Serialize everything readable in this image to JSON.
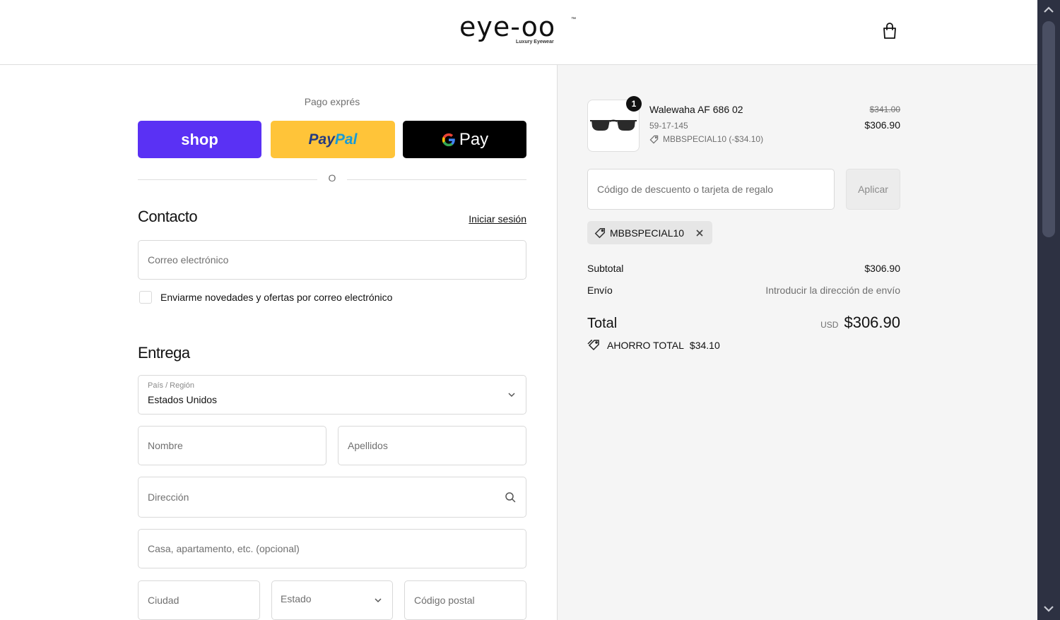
{
  "header": {
    "brand": "eye-oo",
    "brand_tm": "™",
    "brand_sub": "Luxury Eyewear",
    "cart_icon": "shopping-bag-icon"
  },
  "express": {
    "title": "Pago exprés",
    "shop_label": "shop",
    "paypal_part1": "Pay",
    "paypal_part2": "Pal",
    "gpay_label": "Pay",
    "or_label": "O",
    "colors": {
      "shop": "#5a31f4",
      "paypal": "#ffc439",
      "gpay": "#000000"
    }
  },
  "contact": {
    "title": "Contacto",
    "login_link": "Iniciar sesión",
    "email_placeholder": "Correo electrónico",
    "newsletter_label": "Enviarme novedades y ofertas por correo electrónico"
  },
  "delivery": {
    "title": "Entrega",
    "country_label": "País / Región",
    "country_value": "Estados Unidos",
    "first_name_placeholder": "Nombre",
    "last_name_placeholder": "Apellidos",
    "address_placeholder": "Dirección",
    "apartment_placeholder": "Casa, apartamento, etc. (opcional)",
    "city_placeholder": "Ciudad",
    "state_placeholder": "Estado",
    "zip_placeholder": "Código postal"
  },
  "summary": {
    "product": {
      "name": "Walewaha AF 686 02",
      "variant": "59-17-145",
      "discount": "MBBSPECIAL10 (-$34.10)",
      "quantity": "1",
      "old_price": "$341.00",
      "price": "$306.90"
    },
    "discount_placeholder": "Código de descuento o tarjeta de regalo",
    "apply_label": "Aplicar",
    "applied_code": "MBBSPECIAL10",
    "subtotal_label": "Subtotal",
    "subtotal_value": "$306.90",
    "shipping_label": "Envío",
    "shipping_value": "Introducir la dirección de envío",
    "total_label": "Total",
    "currency": "USD",
    "total_value": "$306.90",
    "savings_label": "AHORRO TOTAL",
    "savings_value": "$34.10"
  }
}
